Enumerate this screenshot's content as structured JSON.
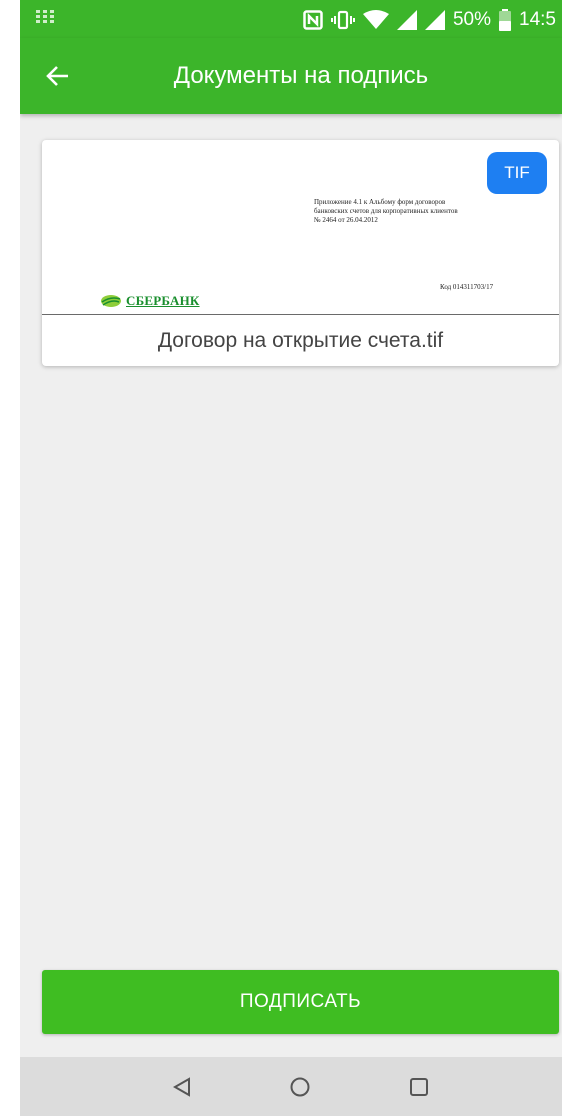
{
  "status_bar": {
    "battery": "50%",
    "time": "14:5",
    "icons": [
      "apps-grid-icon",
      "nfc-icon",
      "vibrate-icon",
      "wifi-icon",
      "signal-icon",
      "signal-icon",
      "battery-icon"
    ]
  },
  "toolbar": {
    "title": "Документы на подпись",
    "back_icon": "arrow-left-icon"
  },
  "document": {
    "badge": "TIF",
    "name": "Договор на открытие счета.tif",
    "preview": {
      "note_line1": "Приложение 4.1 к Альбому форм договоров",
      "note_line2": "банковских счетов для корпоративных клиентов",
      "note_line3": "№ 2464 от 26.04.2012",
      "code": "Код 014311703/17",
      "logo_text": "СБЕРБАНК"
    }
  },
  "sign_button": {
    "label": "ПОДПИСАТЬ"
  },
  "nav_bar": {
    "icons": [
      "back-triangle-icon",
      "home-circle-icon",
      "recents-square-icon"
    ]
  },
  "colors": {
    "green": "#3cb52a",
    "button_green": "#3fbd22",
    "badge_blue": "#1e7ff2"
  }
}
